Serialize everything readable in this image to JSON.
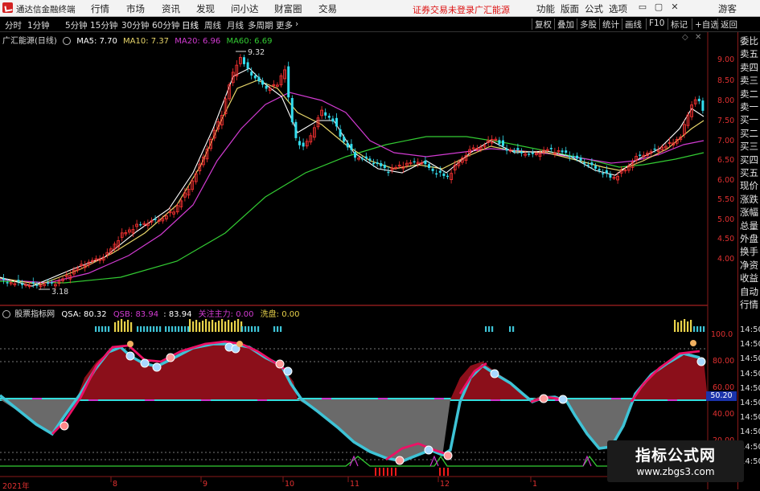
{
  "menubar": {
    "app_title": "通达信金融终端",
    "menus": [
      "行情",
      "市场",
      "资讯",
      "发现",
      "问小达",
      "财富圈",
      "交易"
    ],
    "warning": "证券交易未登录",
    "stock_name": "广汇能源",
    "right_menus": [
      "功能",
      "版面",
      "公式",
      "选项"
    ],
    "guest": "游客"
  },
  "periodbar": {
    "periods": [
      "分时",
      "1分钟",
      "5分钟",
      "15分钟",
      "30分钟",
      "60分钟",
      "日线",
      "周线",
      "月线",
      "多周期",
      "更多"
    ],
    "tools": [
      "复权",
      "叠加",
      "多股",
      "统计",
      "画线",
      "F10",
      "标记",
      "+自选",
      "返回"
    ]
  },
  "main_chart": {
    "title": "广汇能源(日线)",
    "ma5": "MA5: 7.70",
    "ma10": "MA10: 7.37",
    "ma20": "MA20: 6.96",
    "ma60": "MA60: 6.69",
    "high_label": "9.32",
    "low_label": "3.18",
    "y_ticks": [
      "9.00",
      "8.50",
      "8.00",
      "7.50",
      "7.00",
      "6.50",
      "6.00",
      "5.50",
      "5.00",
      "4.50",
      "4.00"
    ],
    "colors": {
      "up": "#ff3333",
      "down": "#33ddee",
      "ma5": "#ffffff",
      "ma10": "#e8d66a",
      "ma20": "#d23bd2",
      "ma60": "#33cc33"
    }
  },
  "indicator": {
    "name": "股票指标网",
    "qsa": "QSA: 80.32",
    "qsb": "QSB: 83.94",
    "qsb2": ": 83.94",
    "zhuli": "关注主力: 0.00",
    "xipan": "洗盘: 0.00",
    "y_ticks": [
      "100.0",
      "80.00",
      "60.00",
      "40.00",
      "20.00"
    ],
    "badge": "50.20"
  },
  "x_axis": {
    "labels": [
      "2021年",
      "8",
      "9",
      "10",
      "11",
      "12",
      "1"
    ]
  },
  "right_panel": {
    "items": [
      "委比",
      "卖五",
      "卖四",
      "卖三",
      "卖二",
      "卖一",
      "买一",
      "买二",
      "买三",
      "买四",
      "买五",
      "现价",
      "涨跌",
      "涨幅",
      "总量",
      "外盘",
      "换手",
      "净资",
      "收益",
      "自动",
      "行情",
      "14:50",
      "14:50",
      "14:50",
      "14:50",
      "14:50",
      "14:50",
      "14:50",
      "14:50",
      "14:50",
      "14:50"
    ]
  },
  "watermark": {
    "line1": "指标公式网",
    "line2": "www.zbgs3.com"
  }
}
